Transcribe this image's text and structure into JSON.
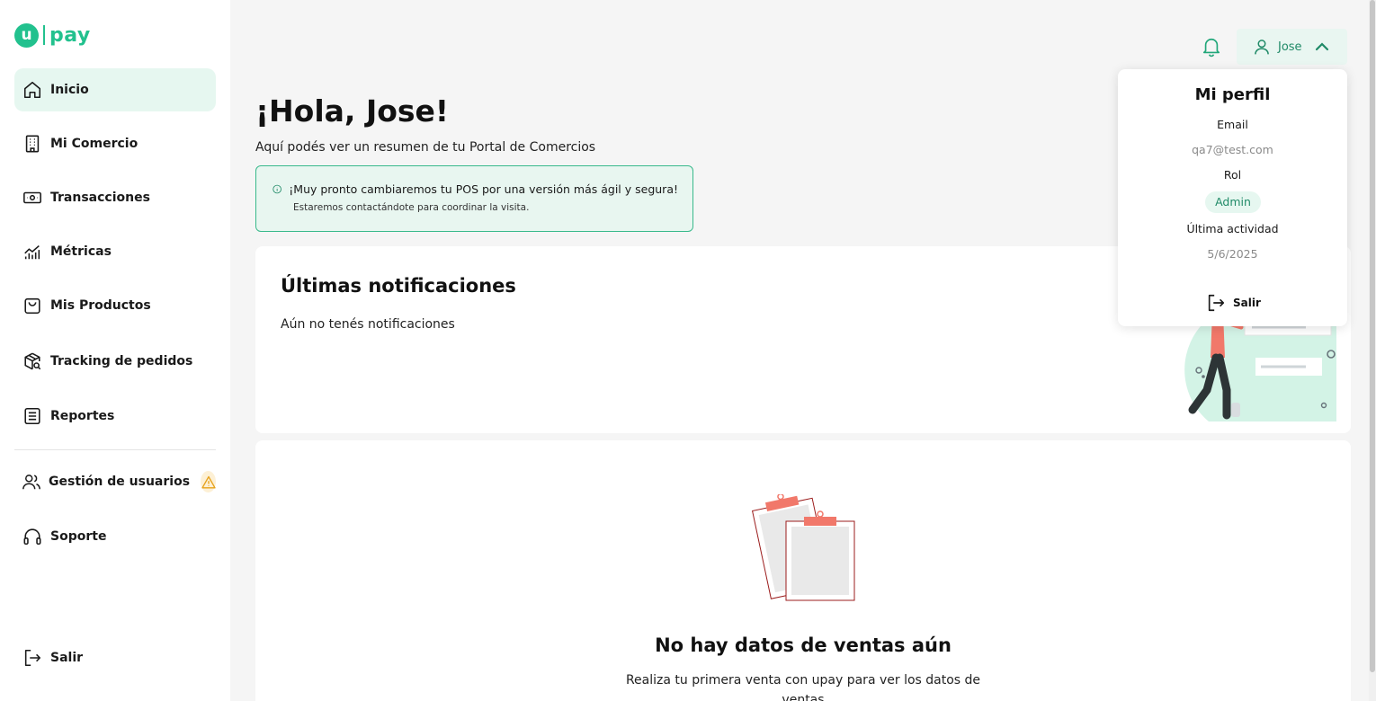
{
  "brand": {
    "logo_letter": "u",
    "logo_text": "pay",
    "color": "#22c18e"
  },
  "sidebar": {
    "items": [
      {
        "label": "Inicio",
        "icon": "home-icon",
        "active": true
      },
      {
        "label": "Mi Comercio",
        "icon": "building-icon"
      },
      {
        "label": "Transacciones",
        "icon": "cash-icon"
      },
      {
        "label": "Métricas",
        "icon": "chart-icon"
      },
      {
        "label": "Mis Productos",
        "icon": "bag-icon"
      },
      {
        "label": "Tracking de pedidos",
        "icon": "package-search-icon"
      },
      {
        "label": "Reportes",
        "icon": "list-icon"
      },
      {
        "label": "Gestión de usuarios",
        "icon": "users-icon",
        "badge": "warning-icon"
      },
      {
        "label": "Soporte",
        "icon": "headset-icon"
      }
    ],
    "logout_label": "Salir"
  },
  "header": {
    "user_name": "Jose"
  },
  "greeting": {
    "title": "¡Hola, Jose!",
    "subtitle": "Aquí podés ver un resumen de tu Portal de Comercios"
  },
  "info_banner": {
    "title": "¡Muy pronto cambiaremos tu POS por una versión más ágil y segura!",
    "subtitle": "Estaremos contactándote para coordinar la visita."
  },
  "notifications": {
    "title": "Últimas notificaciones",
    "empty": "Aún no tenés notificaciones"
  },
  "sales": {
    "title": "No hay datos de ventas aún",
    "subtitle": "Realiza tu primera venta con upay para ver los datos de ventas"
  },
  "profile_menu": {
    "title": "Mi perfil",
    "email_label": "Email",
    "email": "qa7@test.com",
    "role_label": "Rol",
    "role": "Admin",
    "last_activity_label": "Última actividad",
    "last_activity": "5/6/2025",
    "logout_label": "Salir"
  }
}
